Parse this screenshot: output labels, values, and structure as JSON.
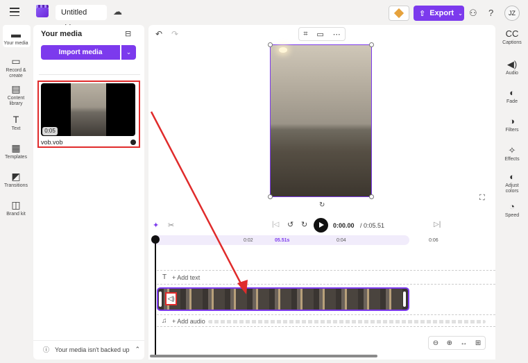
{
  "header": {
    "project_title": "Untitled video",
    "export_label": "Export",
    "avatar_initials": "JZ"
  },
  "left_rail": [
    {
      "label": "Your media",
      "icon": "folder-icon",
      "glyph": "▬"
    },
    {
      "label": "Record & create",
      "icon": "camera-icon",
      "glyph": "▭"
    },
    {
      "label": "Content library",
      "icon": "library-icon",
      "glyph": "▤"
    },
    {
      "label": "Text",
      "icon": "text-icon",
      "glyph": "T"
    },
    {
      "label": "Templates",
      "icon": "templates-icon",
      "glyph": "▦"
    },
    {
      "label": "Transitions",
      "icon": "transitions-icon",
      "glyph": "◩"
    },
    {
      "label": "Brand kit",
      "icon": "brand-kit-icon",
      "glyph": "◫"
    }
  ],
  "media_panel": {
    "title": "Your media",
    "import_label": "Import media",
    "item": {
      "name": "vob.vob",
      "duration": "0:05"
    },
    "backup_notice": "Your media isn't backed up"
  },
  "timeline": {
    "current_time": "0:00.00",
    "total_time": "/ 0:05.51",
    "ruler_ticks": [
      "0:02",
      "05.51s",
      "0:04",
      "0:06"
    ],
    "add_text": "+ Add text",
    "add_audio": "+ Add audio"
  },
  "right_rail": [
    {
      "label": "Captions",
      "icon": "captions-icon",
      "glyph": "CC"
    },
    {
      "label": "Audio",
      "icon": "speaker-icon",
      "glyph": "◀)"
    },
    {
      "label": "Fade",
      "icon": "fade-icon",
      "glyph": "◐"
    },
    {
      "label": "Filters",
      "icon": "filters-icon",
      "glyph": "◑"
    },
    {
      "label": "Effects",
      "icon": "effects-icon",
      "glyph": "✧"
    },
    {
      "label": "Adjust colors",
      "icon": "adjust-colors-icon",
      "glyph": "◐"
    },
    {
      "label": "Speed",
      "icon": "speed-icon",
      "glyph": "◔"
    }
  ],
  "colors": {
    "accent": "#7c3aed",
    "highlight": "#e02b2b"
  }
}
